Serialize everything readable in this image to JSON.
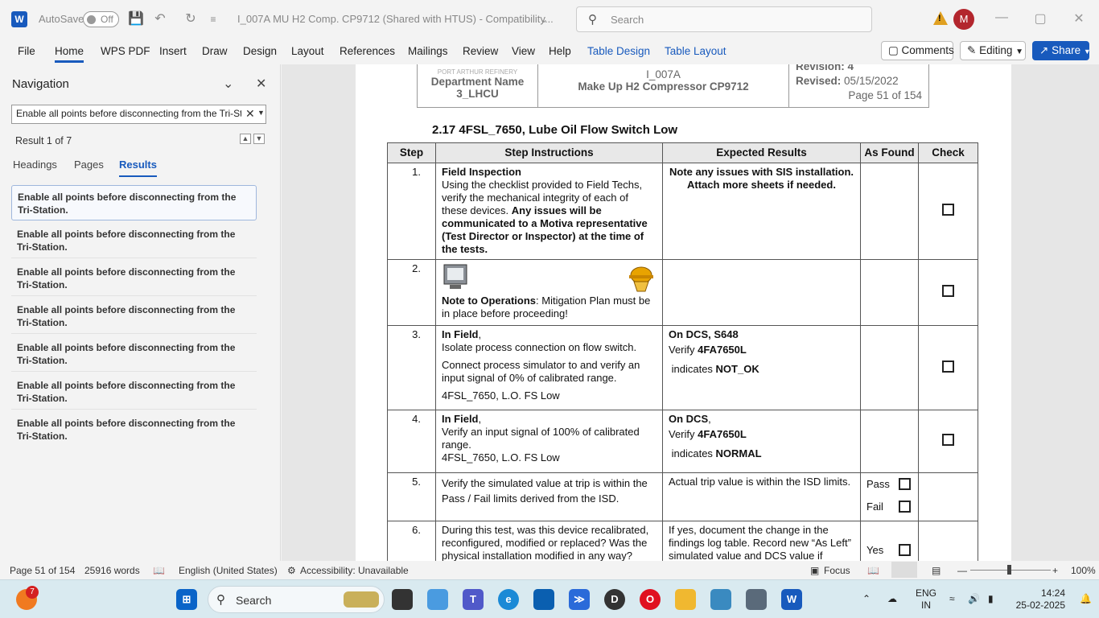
{
  "titlebar": {
    "autosave_label": "AutoSave",
    "autosave_state": "Off",
    "doc_title": "I_007A MU H2 Comp. CP9712 (Shared with HTUS)  -  Compatibility...",
    "search_placeholder": "Search",
    "avatar_initial": "M",
    "warning_glyph": "!"
  },
  "ribbon": {
    "tabs": [
      "File",
      "Home",
      "WPS PDF",
      "Insert",
      "Draw",
      "Design",
      "Layout",
      "References",
      "Mailings",
      "Review",
      "View",
      "Help",
      "Table Design",
      "Table Layout"
    ],
    "comments": "Comments",
    "editing": "Editing",
    "share": "Share"
  },
  "nav": {
    "title": "Navigation",
    "search_value": "Enable all points before disconnecting from the Tri-Station.",
    "result_count": "Result 1 of 7",
    "tabs": [
      "Headings",
      "Pages",
      "Results"
    ],
    "results": [
      "Enable all points before disconnecting from the Tri-Station.",
      "Enable all points before disconnecting from the Tri-Station.",
      "Enable all points before disconnecting from the Tri-Station.",
      "Enable all points before disconnecting from the Tri-Station.",
      "Enable all points before disconnecting from the Tri-Station.",
      "Enable all points before disconnecting from the Tri-Station.",
      "Enable all points before disconnecting from the Tri-Station."
    ]
  },
  "doc": {
    "header": {
      "logo_text": "PORT ARTHUR REFINERY",
      "dept_name": "Department Name",
      "dept_code": "3_LHCU",
      "doc_id": "I_007A",
      "doc_title": "Make Up H2 Compressor CP9712",
      "revision_label": "Revision:",
      "revision": "4",
      "revised_label": "Revised:",
      "revised": "05/15/2022",
      "page": "Page 51 of 154"
    },
    "section_title": "2.17    4FSL_7650, Lube Oil Flow Switch Low",
    "columns": [
      "Step",
      "Step Instructions",
      "Expected Results",
      "As Found",
      "Check"
    ],
    "rows": [
      {
        "step": "1.",
        "title": "Field Inspection",
        "text1": "Using the checklist provided to Field Techs, verify the mechanical integrity of each of these devices.",
        "text2": "Any issues will be communicated to a Motiva representative (Test Director or Inspector) at the time of the tests.",
        "expected": "Note any issues with SIS installation. Attach more sheets if needed."
      },
      {
        "step": "2.",
        "note_label": "Note to Operations",
        "note_text": ": Mitigation Plan must be in place before proceeding!"
      },
      {
        "step": "3.",
        "title": "In Field",
        "comma": ",",
        "line1": "Isolate process connection on flow switch.",
        "line2": "Connect process simulator to and verify an input signal of 0% of calibrated range.",
        "line3": "4FSL_7650, L.O. FS Low",
        "exp1": "On DCS, S648",
        "exp2_prefix": "Verify ",
        "exp2_tag": "4FA7650L",
        "exp3_prefix": " indicates ",
        "exp3_val": "NOT_OK"
      },
      {
        "step": "4.",
        "title": "In Field",
        "comma": ",",
        "line1": "Verify an input signal of 100% of calibrated range.",
        "line3": "4FSL_7650, L.O. FS Low",
        "exp1": "On DCS",
        "exp1_comma": ",",
        "exp2_prefix": "Verify ",
        "exp2_tag": "4FA7650L",
        "exp3_prefix": " indicates ",
        "exp3_val": "NORMAL"
      },
      {
        "step": "5.",
        "line1": "Verify the simulated value at trip is within the Pass / Fail limits derived from the ISD.",
        "expected": "Actual trip value is within the ISD limits.",
        "pass": "Pass",
        "fail": "Fail"
      },
      {
        "step": "6.",
        "line1": "During this test, was this device recalibrated, reconfigured, modified or replaced? Was the physical installation modified in any way?",
        "expected": "If yes, document the change in the findings log table. Record new “As Left” simulated value and DCS value if",
        "yes": "Yes"
      }
    ]
  },
  "status": {
    "page": "Page 51 of 154",
    "words": "25916 words",
    "language": "English (United States)",
    "accessibility": "Accessibility: Unavailable",
    "focus": "Focus",
    "zoom": "100%"
  },
  "taskbar": {
    "search": "Search",
    "badge": "7",
    "lang_top": "ENG",
    "lang_bottom": "IN",
    "time": "14:24",
    "date": "25-02-2025"
  }
}
